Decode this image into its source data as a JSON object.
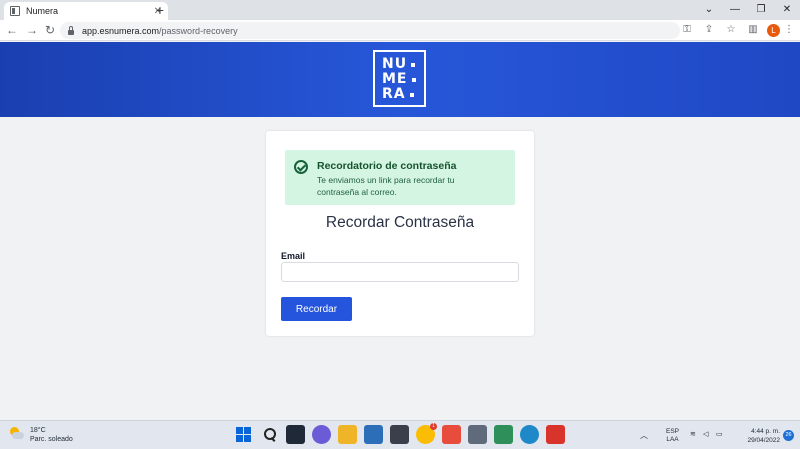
{
  "browser": {
    "tab_title": "Numera",
    "tab_close": "✕",
    "new_tab": "+",
    "url_domain": "app.esnumera.com",
    "url_path": "/password-recovery",
    "profile_initial": "L",
    "icons": [
      "back-icon",
      "forward-icon",
      "reload-icon",
      "lock-icon",
      "key-icon",
      "share-icon",
      "star-icon",
      "sidebar-icon",
      "menu-icon"
    ]
  },
  "window_controls": {
    "chevron": "⌄",
    "minimize": "—",
    "restore": "❐",
    "close": "✕"
  },
  "logo": {
    "row1": "NU",
    "row2": "ME",
    "row3": "RA"
  },
  "alert": {
    "title": "Recordatorio de contraseña",
    "message": "Te enviamos un link para recordar tu contraseña al correo."
  },
  "form": {
    "title": "Recordar Contraseña",
    "email_label": "Email",
    "email_value": "",
    "submit_label": "Recordar"
  },
  "taskbar": {
    "weather_temp": "18°C",
    "weather_desc": "Parc. soleado",
    "lang_line1": "ESP",
    "lang_line2": "LAA",
    "time": "4:44 p. m.",
    "date": "29/04/2022",
    "notification_count": "26",
    "chrome_badge": "1"
  },
  "colors": {
    "banner": "#1f48c4",
    "primary_button": "#2455dc",
    "alert_bg": "#d5f5e3",
    "alert_text": "#14532d"
  }
}
